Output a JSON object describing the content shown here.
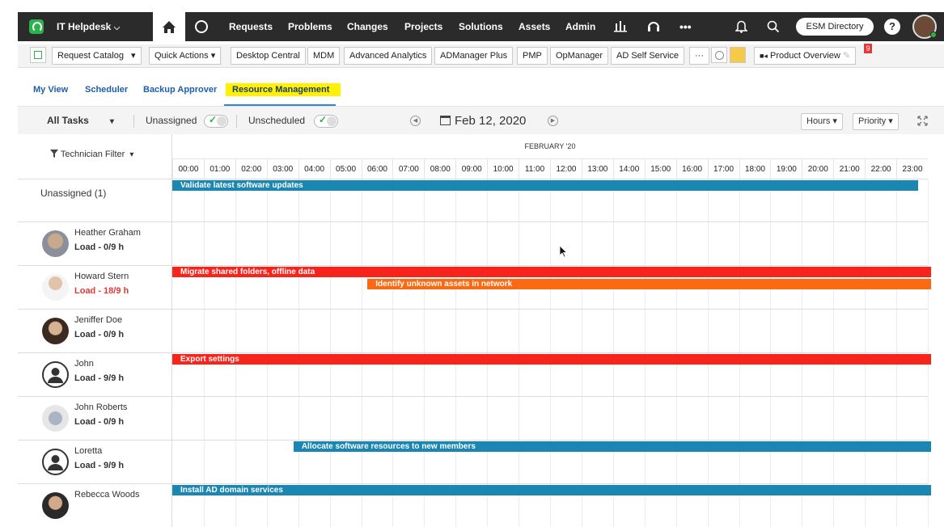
{
  "topnav": {
    "app_name": "IT Helpdesk",
    "items": [
      "Requests",
      "Problems",
      "Changes",
      "Projects",
      "Solutions",
      "Assets",
      "Admin"
    ],
    "more_label": "•••",
    "directory_label": "ESM Directory",
    "help_label": "?"
  },
  "toolbar": {
    "items": [
      "Request Catalog",
      "Quick Actions",
      "Desktop Central",
      "MDM",
      "Advanced Analytics",
      "ADManager Plus",
      "PMP",
      "OpManager",
      "AD Self Service"
    ],
    "overflow_label": "···",
    "product_overview": "Product Overview",
    "badge_count": "9"
  },
  "tabs": {
    "items": [
      "My View",
      "Scheduler",
      "Backup Approver",
      "Resource Management"
    ],
    "active": "Resource Management"
  },
  "controls": {
    "filter_label": "All Tasks",
    "unassigned_label": "Unassigned",
    "unscheduled_label": "Unscheduled",
    "date_label": "Feb 12, 2020",
    "hours_label": "Hours",
    "priority_label": "Priority"
  },
  "schedule": {
    "tech_filter_label": "Technician Filter",
    "month_label": "FEBRUARY '20",
    "hours": [
      "00:00",
      "01:00",
      "02:00",
      "03:00",
      "04:00",
      "05:00",
      "06:00",
      "07:00",
      "08:00",
      "09:00",
      "10:00",
      "11:00",
      "12:00",
      "13:00",
      "14:00",
      "15:00",
      "16:00",
      "17:00",
      "18:00",
      "19:00",
      "20:00",
      "21:00",
      "22:00",
      "23:00"
    ],
    "unassigned_label": "Unassigned (1)",
    "technicians": [
      {
        "name": "Heather Graham",
        "load": "Load - 0/9 h",
        "overload": false
      },
      {
        "name": "Howard Stern",
        "load": "Load - 18/9 h",
        "overload": true
      },
      {
        "name": "Jeniffer Doe",
        "load": "Load - 0/9 h",
        "overload": false
      },
      {
        "name": "John",
        "load": "Load - 9/9 h",
        "overload": false
      },
      {
        "name": "John Roberts",
        "load": "Load - 0/9 h",
        "overload": false
      },
      {
        "name": "Loretta",
        "load": "Load - 9/9 h",
        "overload": false
      },
      {
        "name": "Rebecca Woods",
        "load": "",
        "overload": false
      }
    ],
    "tasks": [
      {
        "label": "Validate latest software updates",
        "color": "#1b86b1"
      },
      {
        "label": "Migrate shared folders, offline data",
        "color": "#f7241c"
      },
      {
        "label": "Identify unknown assets in network",
        "color": "#fb6a12"
      },
      {
        "label": "Export settings",
        "color": "#f7241c"
      },
      {
        "label": "Allocate software resources to new members",
        "color": "#1b86b1"
      },
      {
        "label": "Install AD domain services",
        "color": "#1b86b1"
      }
    ]
  },
  "colors": {
    "accent": "#1d5fa8",
    "highlight": "#fff100",
    "overload": "#e53935",
    "nav_bg": "#2b2b2b"
  }
}
